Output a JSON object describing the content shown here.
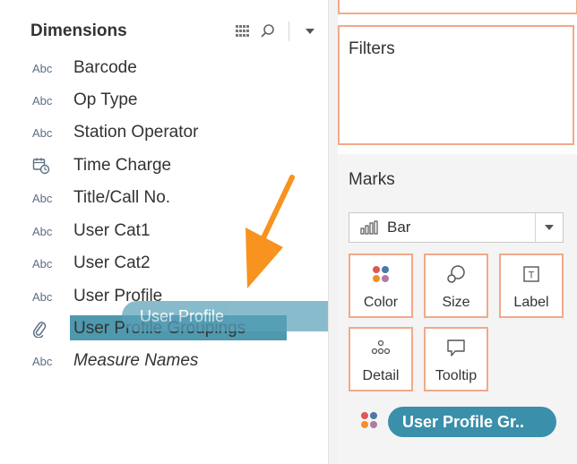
{
  "data_pane": {
    "header": "Dimensions",
    "tools": [
      "grid-view-icon",
      "search-icon",
      "menu-dropdown-icon"
    ],
    "fields": [
      {
        "type": "Abc",
        "name": "Barcode"
      },
      {
        "type": "Abc",
        "name": "Op Type"
      },
      {
        "type": "Abc",
        "name": "Station Operator"
      },
      {
        "type": "date-time-icon",
        "name": "Time Charge"
      },
      {
        "type": "Abc",
        "name": "Title/Call No."
      },
      {
        "type": "Abc",
        "name": "User Cat1"
      },
      {
        "type": "Abc",
        "name": "User Cat2"
      },
      {
        "type": "Abc",
        "name": "User Profile"
      },
      {
        "type": "paperclip-icon",
        "name": "User Profile Groupings"
      },
      {
        "type": "Abc",
        "name": "Measure Names"
      }
    ]
  },
  "drag": {
    "label": "User Profile",
    "arrow_color": "#f7931e"
  },
  "filters": {
    "title": "Filters"
  },
  "marks": {
    "title": "Marks",
    "mark_type": "Bar",
    "buttons": [
      {
        "label": "Color",
        "icon": "color-dots-icon"
      },
      {
        "label": "Size",
        "icon": "size-icon"
      },
      {
        "label": "Label",
        "icon": "label-icon"
      },
      {
        "label": "Detail",
        "icon": "detail-dots-icon"
      },
      {
        "label": "Tooltip",
        "icon": "tooltip-icon"
      }
    ],
    "color_pill": "User Profile Gr.."
  },
  "colors": {
    "accent_border": "#f1a98b",
    "pill_blue": "#3a8fab",
    "highlight_blue": "#2f87a0",
    "arrow_orange": "#f7931e"
  }
}
